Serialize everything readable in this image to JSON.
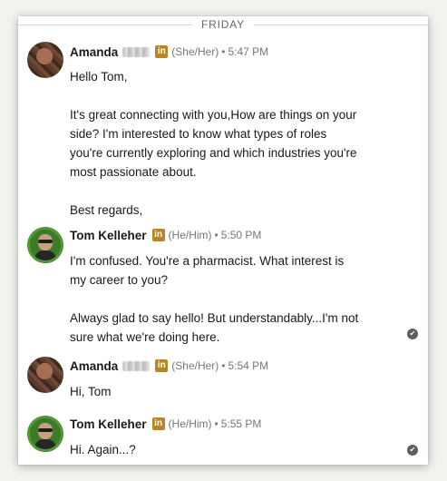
{
  "day_divider": "FRIDAY",
  "messages": [
    {
      "sender": "Amanda",
      "badge": "in",
      "pronouns": "(She/Her)",
      "separator": "•",
      "time": "5:47 PM",
      "paragraphs": [
        "Hello Tom,",
        "It's great connecting with you,How are things on your\nside? I'm interested to know what types of roles\nyou're currently exploring and which industries you're\nmost passionate about.",
        "Best regards,"
      ]
    },
    {
      "sender": "Tom Kelleher",
      "badge": "in",
      "pronouns": "(He/Him)",
      "separator": "•",
      "time": "5:50 PM",
      "paragraphs": [
        "I'm confused.  You're a pharmacist.  What interest is\nmy career to you?",
        "Always glad to say hello!  But understandably...I'm not\nsure what we're doing here."
      ],
      "seen_icon": "read-check-icon"
    },
    {
      "sender": "Amanda",
      "badge": "in",
      "pronouns": "(She/Her)",
      "separator": "•",
      "time": "5:54 PM",
      "paragraphs": [
        "Hi, Tom"
      ]
    },
    {
      "sender": "Tom Kelleher",
      "badge": "in",
      "pronouns": "(He/Him)",
      "separator": "•",
      "time": "5:55 PM",
      "paragraphs": [
        "Hi.  Again...?"
      ],
      "seen_icon": "read-check-icon"
    }
  ],
  "check_glyph": "✔",
  "colors": {
    "premium_badge": "#b98524",
    "meta_text": "#767676",
    "body_text": "#191919"
  }
}
